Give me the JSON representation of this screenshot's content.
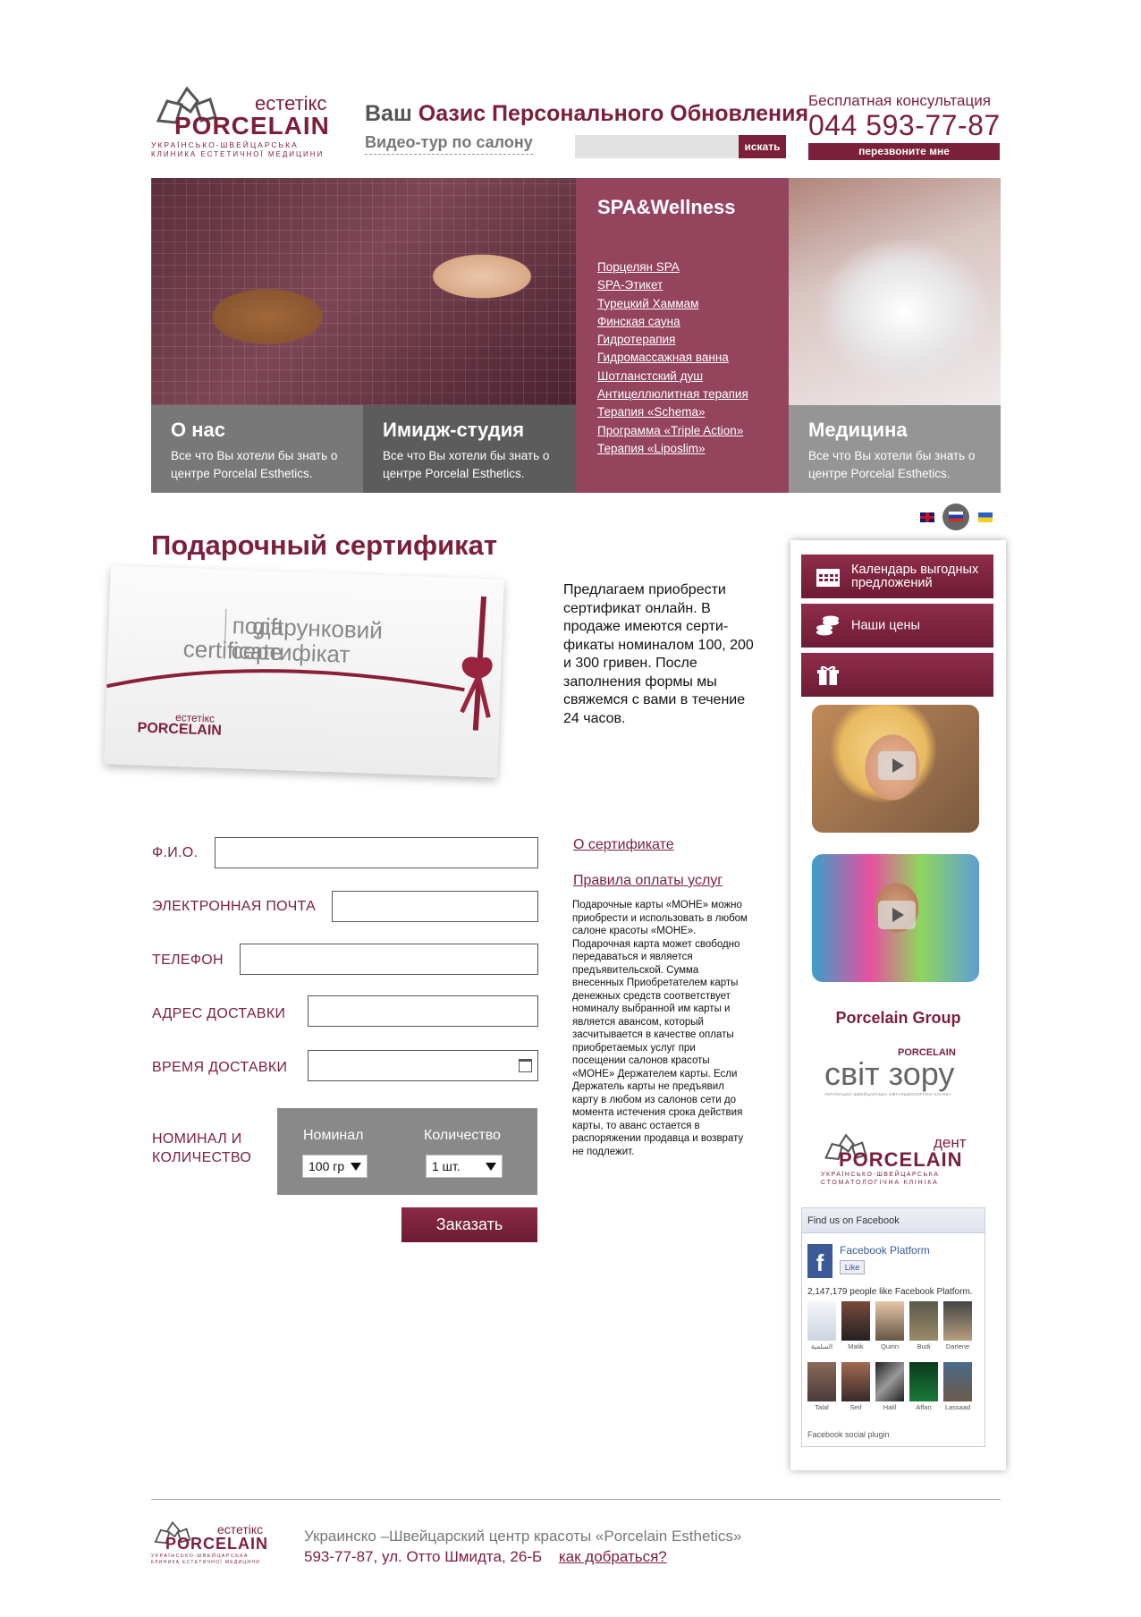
{
  "header": {
    "logo": {
      "brand": "PORCELAIN",
      "sub": "естетікс",
      "tagline_1": "УКРАЇНСЬКО-ШВЕЙЦАРСЬКА",
      "tagline_2": "КЛИНИКА ЕСТЕТИЧНОЇ МЕДИЦИНИ"
    },
    "slogan_prefix": "Ваш",
    "slogan_highlight": "Оазис Персонального Обновления",
    "video_tour": "Видео-тур по салону",
    "search": {
      "placeholder": "",
      "button": "искать"
    },
    "consult_label": "Бесплатная консультация",
    "phone": "044 593-77-87",
    "callback_button": "перезвоните мне"
  },
  "banner": {
    "spa": {
      "title": "SPA&Wellness",
      "links": [
        "Порцелян SPA",
        "SPA-Этикет",
        "Турецкий Хаммам",
        "Финская сауна",
        "Гидротерапия",
        "Гидромассажная ванна",
        "Шотланстский душ",
        "Антицеллюлитная терапия",
        "Терапия «Schema»",
        "Программа «Triple Action»",
        "Терапия «Liposlim»"
      ]
    },
    "tiles": [
      {
        "title": "О нас",
        "desc": "Все что Вы хотели бы знать о центре Porcelal Esthetics."
      },
      {
        "title": "Имидж-студия",
        "desc": "Все что Вы хотели бы знать о центре Porcelal Esthetics."
      },
      {
        "title": "Медицина",
        "desc": "Все что Вы хотели бы знать о центре Porcelal Esthetics."
      }
    ]
  },
  "languages": [
    "en",
    "ru",
    "ua"
  ],
  "main": {
    "title": "Подарочный сертификат",
    "certificate": {
      "gift_1": "gift",
      "gift_2": "certificate",
      "ua_1": "подарунковий",
      "ua_2": "сертифікат",
      "brand": "PORCELAIN",
      "brand_sub": "естетікс"
    },
    "intro": "Предлагаем приобрести сертификат онлайн. В продаже имеются серти­фикаты номиналом 100, 200 и 300 гривен. После заполнения формы мы свяжемся с вами в течение 24 часов.",
    "form": {
      "name_label": "Ф.И.О.",
      "email_label": "ЭЛЕКТРОННАЯ ПОЧТА",
      "phone_label": "ТЕЛЕФОН",
      "address_label": "АДРЕС ДОСТАВКИ",
      "time_label": "ВРЕМЯ ДОСТАВКИ",
      "qty_label_1": "НОМИНАЛ И",
      "qty_label_2": "КОЛИЧЕСТВО",
      "nominal_header": "Номинал",
      "quantity_header": "Количество",
      "nominal_value": "100 гр",
      "quantity_value": "1 шт.",
      "submit": "Заказать"
    },
    "links": {
      "about_cert": "О сертификате",
      "payment_rules": "Правила оплаты услуг"
    },
    "rules_text": "Подарочные карты «МОНЕ» можно приобрести и использо­вать в любом салоне красоты «МОНЕ». Подарочная карта может свободно передаваться и является предъявительской. Сумма внесенных Приобретате­лем карты денежных средств соответствует номиналу выбранной им карты и является авансом, который засчитыва­ется в качестве оплаты приоб­ретаемых услуг при посещении салонов красоты «МОНЕ» Дер­жателем карты. Если Держатель карты не предъявил карту в любом из салонов сети до момента исте­чения срока действия карты, то аванс остается в распоряжении продавца и возврату не подлежит."
  },
  "sidebar": {
    "buttons": [
      {
        "label": "Календарь выгодных предложений",
        "icon": "calendar-icon"
      },
      {
        "label": "Наши цены",
        "icon": "coins-icon"
      },
      {
        "label": "",
        "icon": "gift-icon"
      }
    ],
    "group_title": "Porcelain Group",
    "partner_1": {
      "main": "світ зору",
      "brand": "PORCELAIN",
      "tag": "УКРАЇНСЬКО-ШВЕЙЦАРСЬКА ОФТАЛЬМОЛОГІЧНА КЛІНІКА"
    },
    "partner_2": {
      "main": "PORCELAIN",
      "sub": "дент",
      "tag_1": "УКРАЇНСЬКО-ШВЕЙЦАРСЬКА",
      "tag_2": "СТОМАТОЛОГІЧНА КЛІНІКА"
    },
    "facebook": {
      "header": "Find us on Facebook",
      "page_name": "Facebook Platform",
      "like": "Like",
      "count_text": "2,147,179 people like Facebook Platform.",
      "names_row1": [
        "السلمية",
        "Malik",
        "Quinn",
        "Budi",
        "Darlene"
      ],
      "names_row2": [
        "Talal",
        "Seif",
        "Halil",
        "Affan",
        "Lassaad"
      ],
      "plugin": "Facebook social plugin"
    }
  },
  "footer": {
    "line1": "Украинско –Швейцарский центр красоты «Porcelain Esthetics»",
    "line2": "593-77-87, ул. Отто Шмидта, 26-Б",
    "directions": "как добраться?"
  },
  "colors": {
    "accent": "#7b1f3a",
    "gray_panel": "#898989"
  }
}
